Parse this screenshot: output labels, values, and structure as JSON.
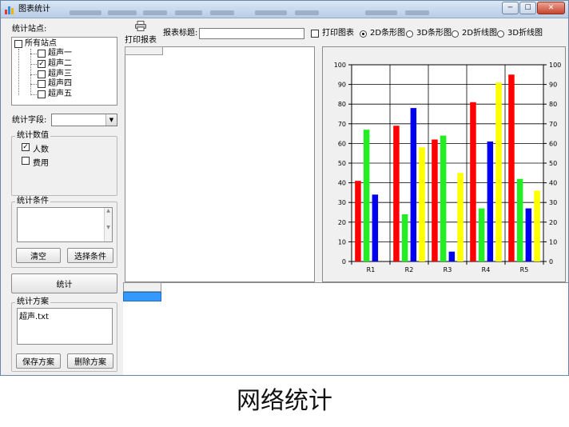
{
  "window": {
    "title": "图表统计",
    "buttons": {
      "min": "─",
      "max": "☐",
      "close": "✕"
    }
  },
  "left_panel": {
    "stations_label": "统计站点:",
    "tree": {
      "root": {
        "label": "所有站点",
        "checked": false
      },
      "children": [
        {
          "label": "超声一",
          "checked": false
        },
        {
          "label": "超声二",
          "checked": true
        },
        {
          "label": "超声三",
          "checked": false
        },
        {
          "label": "超声四",
          "checked": false
        },
        {
          "label": "超声五",
          "checked": false
        }
      ]
    },
    "field_label": "统计字段:",
    "field_value": "",
    "values_group": {
      "legend": "统计数值",
      "items": [
        {
          "label": "人数",
          "checked": true
        },
        {
          "label": "费用",
          "checked": false
        }
      ]
    },
    "conditions_group": {
      "legend": "统计条件",
      "clear_button": "清空",
      "select_button": "选择条件"
    },
    "run_button": "统计",
    "plan_group": {
      "legend": "统计方案",
      "items": [
        "超声.txt"
      ],
      "save_button": "保存方案",
      "delete_button": "删除方案"
    }
  },
  "toolbar": {
    "print_report": "打印报表",
    "report_title_label": "报表标题:",
    "report_title_value": "",
    "print_chart_label": "打印图表",
    "print_chart_checked": false,
    "chart_types": [
      {
        "label": "2D条形图",
        "checked": true
      },
      {
        "label": "3D条形图",
        "checked": false
      },
      {
        "label": "2D折线图",
        "checked": false
      },
      {
        "label": "3D折线图",
        "checked": false
      }
    ]
  },
  "caption": "网络统计",
  "colors": {
    "series": [
      "#ff0000",
      "#22ee22",
      "#0000ee",
      "#ffff00"
    ],
    "active_tab": "#3399ff"
  },
  "chart_data": {
    "type": "bar",
    "categories": [
      "R1",
      "R2",
      "R3",
      "R4",
      "R5"
    ],
    "series": [
      {
        "values": [
          41,
          69,
          62,
          81,
          95
        ]
      },
      {
        "values": [
          67,
          24,
          64,
          27,
          42
        ]
      },
      {
        "values": [
          34,
          78,
          5,
          61,
          27
        ]
      },
      {
        "values": [
          null,
          58,
          45,
          91,
          36
        ]
      }
    ],
    "ylim": [
      0,
      100
    ],
    "yticks": [
      0,
      10,
      20,
      30,
      40,
      50,
      60,
      70,
      80,
      90,
      100
    ],
    "secondary_axis": "right",
    "grid": "horizontal+vertical"
  }
}
